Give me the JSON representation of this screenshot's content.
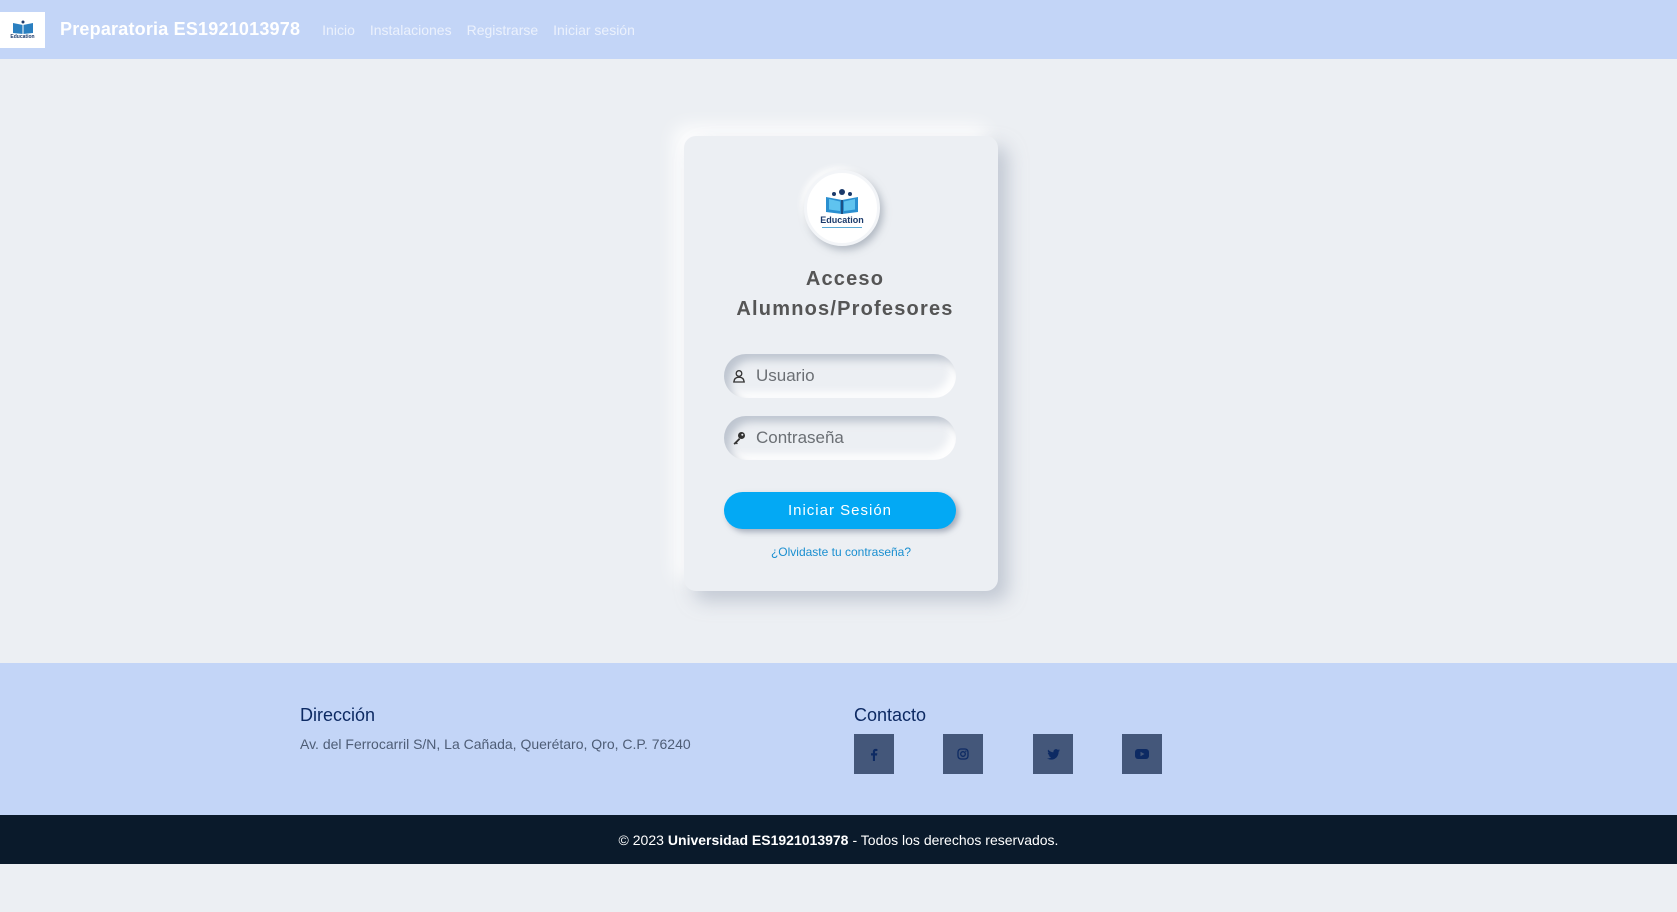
{
  "navbar": {
    "logo_text": "Education",
    "brand": "Preparatoria ES1921013978",
    "links": [
      "Inicio",
      "Instalaciones",
      "Registrarse",
      "Iniciar sesión"
    ]
  },
  "login": {
    "logo_text": "Education",
    "title_line1": "Acceso",
    "title_line2": "Alumnos/Profesores",
    "username_placeholder": "Usuario",
    "password_placeholder": "Contraseña",
    "submit_label": "Iniciar Sesión",
    "forgot_link": "¿Olvidaste tu contraseña?"
  },
  "footer": {
    "address_title": "Dirección",
    "address_text": "Av. del Ferrocarril S/N, La Cañada, Querétaro, Qro, C.P. 76240",
    "contact_title": "Contacto",
    "social": [
      "facebook-icon",
      "instagram-icon",
      "twitter-icon",
      "youtube-icon"
    ],
    "copyright_prefix": "© 2023",
    "copyright_name": "Universidad ES1921013978",
    "copyright_suffix": "- Todos los derechos reservados."
  },
  "colors": {
    "navbar_bg": "#c3d5f7",
    "page_bg": "#eceff3",
    "button_bg": "#03a9f4",
    "social_bg": "#44577a",
    "bottom_bar_bg": "#0a1a2b"
  }
}
